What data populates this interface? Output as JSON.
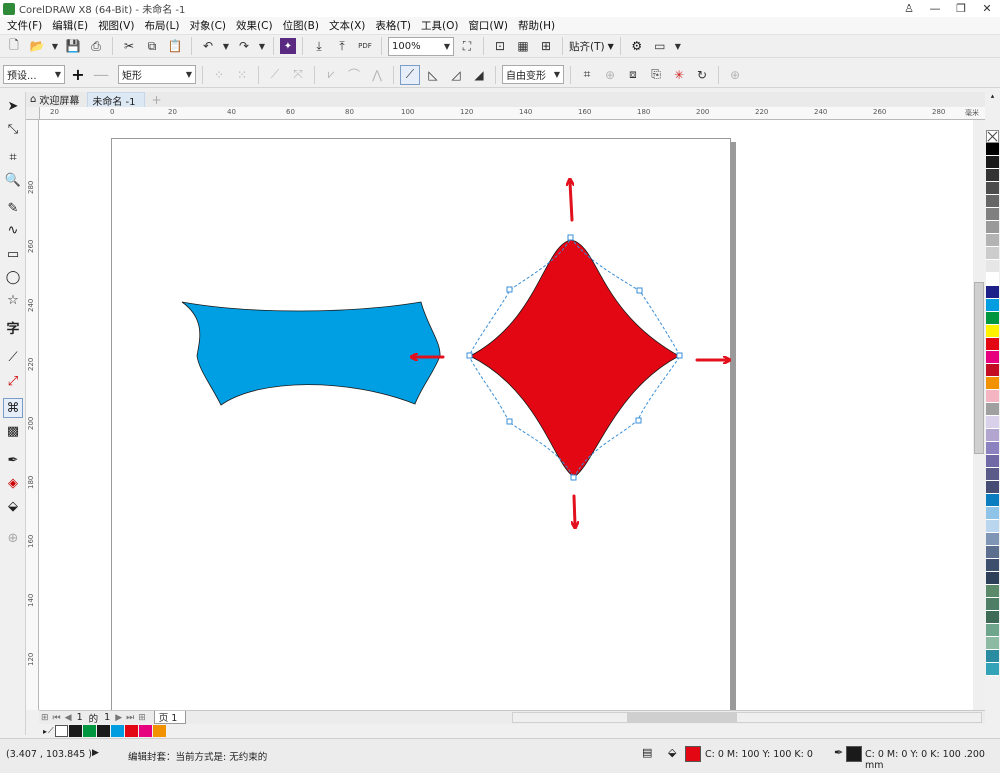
{
  "window": {
    "title": "CorelDRAW X8 (64-Bit) - 未命名 -1",
    "controls": [
      "♙",
      "—",
      "❐",
      "✕"
    ]
  },
  "menu": [
    "文件(F)",
    "编辑(E)",
    "视图(V)",
    "布局(L)",
    "对象(C)",
    "效果(C)",
    "位图(B)",
    "文本(X)",
    "表格(T)",
    "工具(O)",
    "窗口(W)",
    "帮助(H)"
  ],
  "toolbar": {
    "zoom": "100%",
    "snap_label": "贴齐(T)",
    "pdf_label": "PDF"
  },
  "property_bar": {
    "preset": "预设...",
    "shape_type": "矩形",
    "envelope_mode": "自由变形"
  },
  "tabs": {
    "welcome": "欢迎屏幕",
    "document": "未命名 -1",
    "add": "+"
  },
  "rulers": {
    "horizontal": [
      "20",
      "0",
      "20",
      "40",
      "60",
      "80",
      "100",
      "120",
      "140",
      "160",
      "180",
      "200",
      "220",
      "240",
      "260",
      "280",
      "毫米"
    ],
    "vertical": [
      "280",
      "260",
      "240",
      "220",
      "200",
      "180",
      "160",
      "140",
      "120"
    ]
  },
  "page_nav": {
    "current": "1",
    "of": "的",
    "total": "1",
    "page_tab": "页 1"
  },
  "document_palette": [
    "#1a1a1a",
    "#009640",
    "#1a1a1a",
    "#009ee0",
    "#e30613",
    "#e6007e",
    "#f39200"
  ],
  "palette": [
    "#000000",
    "#1a1a1a",
    "#333333",
    "#4d4d4d",
    "#666666",
    "#808080",
    "#999999",
    "#b3b3b3",
    "#cccccc",
    "#e6e6e6",
    "#ffffff",
    "#1d2088",
    "#009ee0",
    "#009640",
    "#fff100",
    "#e30613",
    "#e6007e",
    "#c30d23",
    "#f39200",
    "#f4b4c2",
    "#a0a0a0",
    "#d9d1e9",
    "#b2a6d0",
    "#8c82c0",
    "#6f6aa5",
    "#5b5b8a",
    "#454d74",
    "#0a7cc0",
    "#8fc3e8",
    "#b9d6ee",
    "#7f95b5",
    "#5c6f8e",
    "#3d4f6d",
    "#2e3f5a",
    "#5a8a6a",
    "#4f7e66",
    "#3e6b55",
    "#6ea58c",
    "#8cbaa3",
    "#2a8ca0",
    "#35a3b7"
  ],
  "status": {
    "coords": "(3.407 , 103.845 )",
    "message": "编辑封套：当前方式是: 无约束的",
    "fill": "C: 0 M: 100 Y: 100 K: 0",
    "outline": "C: 0 M: 0 Y: 0 K: 100  .200 mm"
  },
  "colors": {
    "blue_shape": "#009fe3",
    "red_shape": "#e30613",
    "arrow": "#e3101d",
    "envelope": "#3a8fd8"
  }
}
